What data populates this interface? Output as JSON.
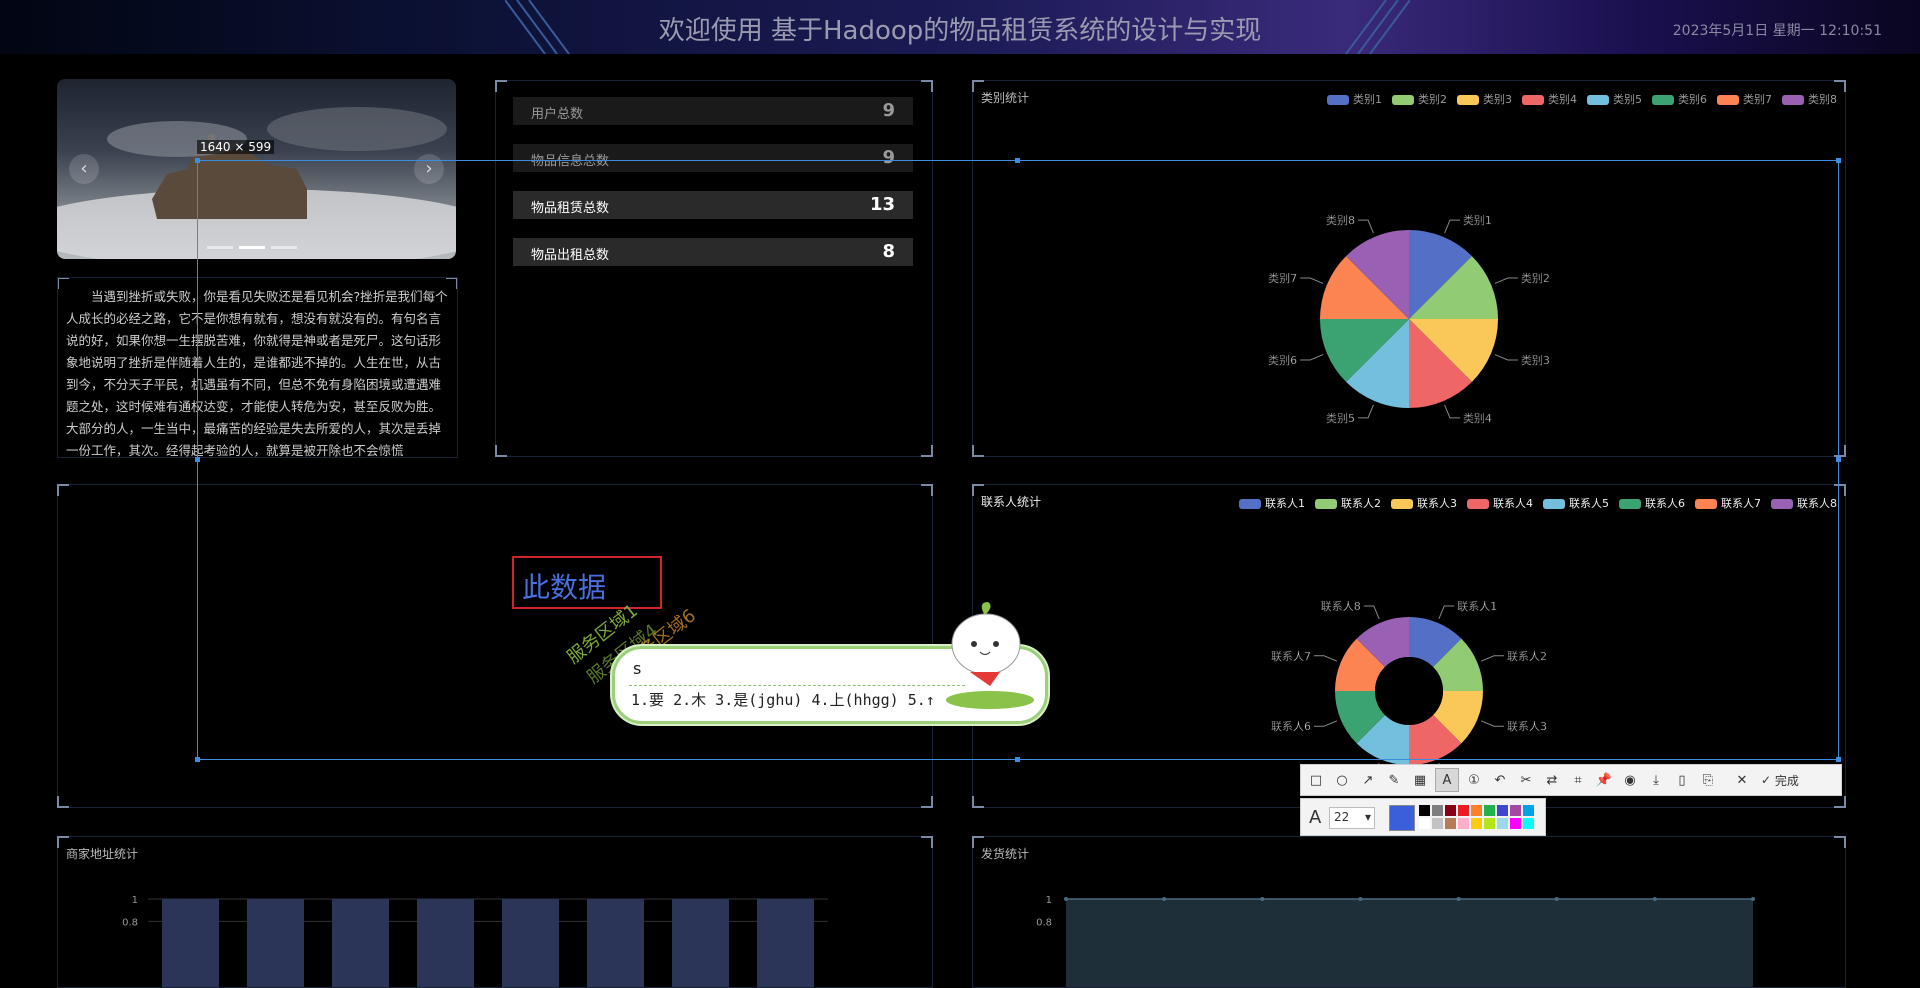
{
  "header": {
    "title": "欢迎使用 基于Hadoop的物品租赁系统的设计与实现",
    "datetime": "2023年5月1日 星期一 12:10:51"
  },
  "carousel": {
    "prev_icon": "chevron-left-icon",
    "next_icon": "chevron-right-icon",
    "prev_glyph": "‹",
    "next_glyph": "›"
  },
  "intro_text": "当遇到挫折或失败，你是看见失败还是看见机会?挫折是我们每个人成长的必经之路，它不是你想有就有，想没有就没有的。有句名言说的好，如果你想一生摆脱苦难，你就得是神或者是死尸。这句话形象地说明了挫折是伴随着人生的，是谁都逃不掉的。人生在世，从古到今，不分天子平民，机遇虽有不同，但总不免有身陷困境或遭遇难题之处，这时候难有通权达变，才能使人转危为安，甚至反败为胜。大部分的人，一生当中，最痛苦的经验是失去所爱的人，其次是丢掉一份工作，其次。经得起考验的人，就算是被开除也不会惊慌",
  "stats": [
    {
      "label": "用户总数",
      "value": "9"
    },
    {
      "label": "物品信息总数",
      "value": "9"
    },
    {
      "label": "物品租赁总数",
      "value": "13"
    },
    {
      "label": "物品出租总数",
      "value": "8"
    }
  ],
  "category_panel": {
    "title": "类别统计"
  },
  "contact_panel": {
    "title": "联系人统计"
  },
  "merchant_panel": {
    "title": "商家地址统计"
  },
  "shipping_panel": {
    "title": "发货统计"
  },
  "colors": {
    "c1": "#5470c6",
    "c2": "#91cc75",
    "c3": "#fac858",
    "c4": "#ee6666",
    "c5": "#73c0de",
    "c6": "#3ba272",
    "c7": "#fc8452",
    "c8": "#9a60b4"
  },
  "chart_data": [
    {
      "type": "pie",
      "title": "类别统计",
      "categories": [
        "类别1",
        "类别2",
        "类别3",
        "类别4",
        "类别5",
        "类别6",
        "类别7",
        "类别8"
      ],
      "values": [
        1,
        1,
        1,
        1,
        1,
        1,
        1,
        1
      ]
    },
    {
      "type": "pie",
      "title": "联系人统计",
      "categories": [
        "联系人1",
        "联系人2",
        "联系人3",
        "联系人4",
        "联系人5",
        "联系人6",
        "联系人7",
        "联系人8"
      ],
      "values": [
        1,
        1,
        1,
        1,
        1,
        1,
        1,
        1
      ]
    },
    {
      "type": "bar",
      "title": "商家地址统计",
      "ytick_labels": [
        "1",
        "0.8"
      ],
      "bar_count": 8,
      "values": [
        1,
        1,
        1,
        1,
        1,
        1,
        1,
        1
      ]
    },
    {
      "type": "area",
      "title": "发货统计",
      "ytick_labels": [
        "1",
        "0.8"
      ],
      "values": [
        1,
        1,
        1,
        1,
        1,
        1,
        1,
        1
      ]
    }
  ],
  "screenshot_tool": {
    "size_label": "1640 × 599",
    "text_box_value": "此数据",
    "font_size": "22",
    "done_label": "完成",
    "tools": [
      "rect-icon",
      "ellipse-icon",
      "arrow-icon",
      "pen-icon",
      "mosaic-icon",
      "text-icon",
      "number-icon",
      "undo-icon",
      "clip-icon",
      "translate-icon",
      "ocr-icon",
      "pin-icon",
      "record-icon",
      "download-icon",
      "save-icon",
      "bookmark-icon",
      "close-icon",
      "check-icon"
    ],
    "palette": [
      "#000000",
      "#7f7f7f",
      "#880015",
      "#ed1c24",
      "#ff7f27",
      "#22b14c",
      "#3f48cc",
      "#a349a4",
      "#00a2e8",
      "#ffffff",
      "#c3c3c3",
      "#b97a57",
      "#ffaec9",
      "#ffc90e",
      "#b5e61d",
      "#99d9ea",
      "#ff00ff",
      "#00ffff"
    ]
  },
  "ime": {
    "input": "s",
    "candidates": "1.要  2.木  3.是(jghu)  4.上(hhgg)  5.↑"
  },
  "stamp": {
    "line1": "服务区域1",
    "line2": "服务区域4",
    "line3": "服务区域6"
  }
}
